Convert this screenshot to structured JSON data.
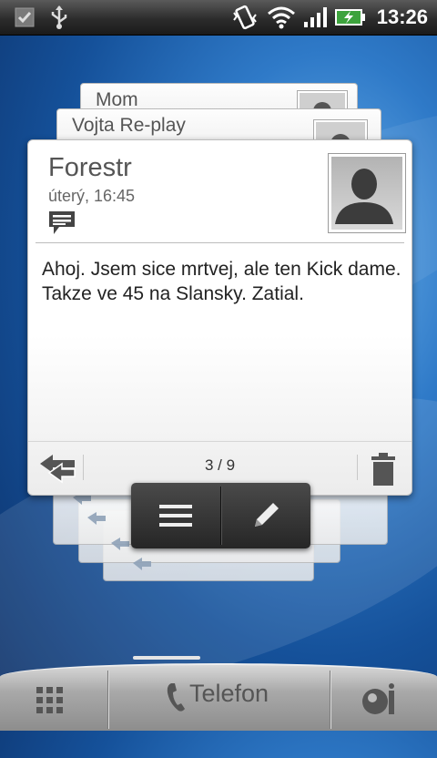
{
  "status_bar": {
    "time": "13:26",
    "icons": [
      "checkbox-notification-icon",
      "usb-icon",
      "vibrate-icon",
      "wifi-icon",
      "signal-icon",
      "battery-charging-icon"
    ]
  },
  "message_stack": {
    "behind_cards": [
      {
        "name": "Mom"
      },
      {
        "name": "Vojta Re-play"
      }
    ],
    "current": {
      "sender": "Forestr",
      "timestamp": "úterý, 16:45",
      "body": "Ahoj. Jsem sice mrtvej, ale ten Kick dame. Takze ve 45 na Slansky. Zatial.",
      "pager": "3 / 9"
    }
  },
  "action_bar": {
    "menu_icon": "list-menu-icon",
    "compose_icon": "pencil-icon"
  },
  "dock": {
    "phone_label": "Telefon",
    "left_icon": "app-grid-icon",
    "right_icon": "contacts-info-icon"
  }
}
